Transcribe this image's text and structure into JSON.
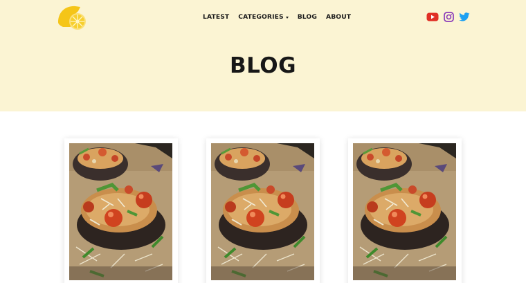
{
  "header": {
    "nav": [
      {
        "label": "LATEST"
      },
      {
        "label": "CATEGORIES"
      },
      {
        "label": "BLOG"
      },
      {
        "label": "ABOUT"
      }
    ],
    "social_icons": [
      "youtube-icon",
      "instagram-icon",
      "twitter-icon"
    ],
    "logo_icon": "lemon-slice-icon"
  },
  "hero": {
    "title": "BLOG",
    "background": "#fbf4d3"
  },
  "posts": [
    {
      "image": "stuffed-portobello-mushroom-photo"
    },
    {
      "image": "stuffed-portobello-mushroom-photo"
    },
    {
      "image": "stuffed-portobello-mushroom-photo"
    }
  ],
  "colors": {
    "youtube": "#e02f25",
    "instagram": "#8a3ab9",
    "twitter": "#1da1f2",
    "logo_yellow": "#f5c518"
  }
}
